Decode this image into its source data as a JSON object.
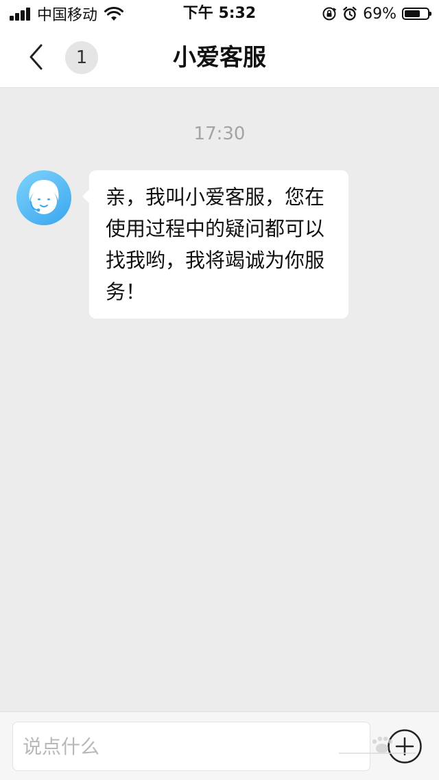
{
  "status_bar": {
    "carrier": "中国移动",
    "time": "下午 5:32",
    "battery_percent": "69%",
    "battery_level": 0.69,
    "icons": [
      "signal-icon",
      "wifi-icon",
      "orientation-lock-icon",
      "alarm-icon",
      "battery-icon"
    ]
  },
  "nav": {
    "back_icon": "chevron-left-icon",
    "unread_count": "1",
    "title": "小爱客服"
  },
  "chat": {
    "timestamp": "17:30",
    "messages": [
      {
        "sender": "agent",
        "avatar_icon": "agent-avatar-icon",
        "text": "亲，我叫小爱客服，您在使用过程中的疑问都可以找我哟，我将竭诚为你服务！"
      }
    ]
  },
  "input": {
    "placeholder": "说点什么",
    "value": "",
    "add_icon": "plus-circle-icon"
  },
  "colors": {
    "chat_background": "#ececec",
    "bar_background": "#ffffff",
    "bubble_background": "#ffffff",
    "avatar_gradient_start": "#7ed3fb",
    "avatar_gradient_end": "#39a6ee",
    "timestamp_text": "#a3a3a3",
    "placeholder_text": "#b8b8b8"
  }
}
